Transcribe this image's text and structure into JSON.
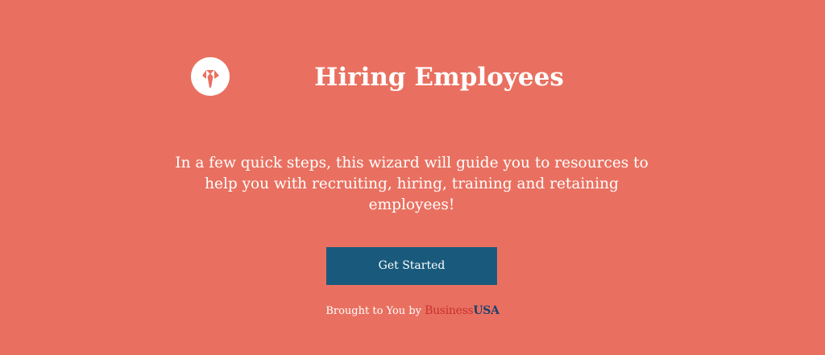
{
  "header": {
    "icon": "necktie-icon",
    "title": "Hiring Employees"
  },
  "intro": {
    "text": "In a few quick steps, this wizard will guide you to resources to help you with recruiting, hiring, training and retaining employees!"
  },
  "cta": {
    "label": "Get Started"
  },
  "credit": {
    "prefix": "Brought to You by ",
    "brand_part1": "Business",
    "brand_part2": "USA"
  },
  "colors": {
    "background": "#E97060",
    "button": "#195A7C",
    "brand_business": "#C9302C",
    "brand_usa": "#1E3F6E"
  }
}
